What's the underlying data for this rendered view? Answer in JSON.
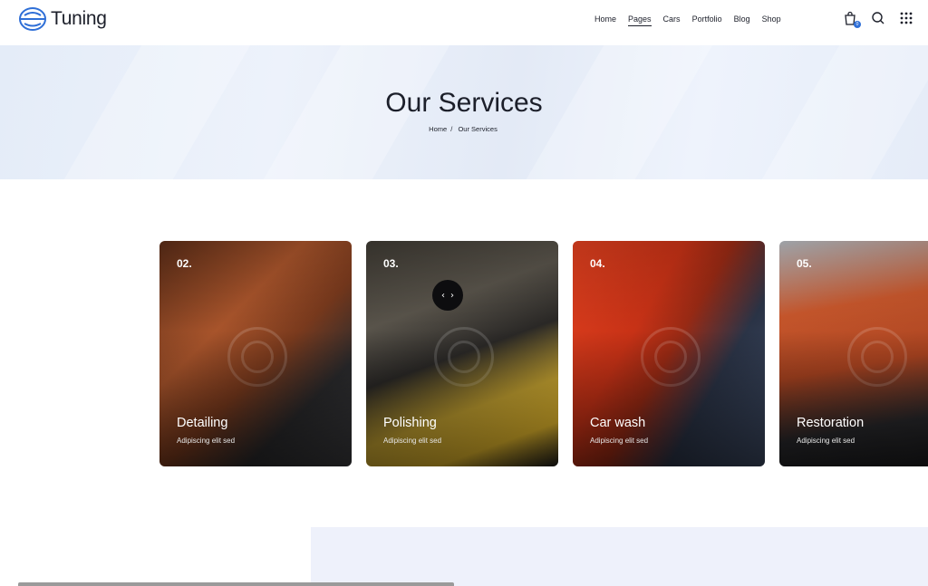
{
  "header": {
    "logo_text": "Tuning",
    "nav": [
      "Home",
      "Pages",
      "Cars",
      "Portfolio",
      "Blog",
      "Shop"
    ],
    "active_nav": "Pages",
    "cart_count": "0",
    "icons": [
      "cart-icon",
      "search-icon",
      "grid-menu-icon"
    ]
  },
  "hero": {
    "title": "Our Services",
    "breadcrumb": {
      "home": "Home",
      "separator": "/",
      "current": "Our Services"
    }
  },
  "services": [
    {
      "number": "02.",
      "title": "Detailing",
      "subtitle": "Adipiscing elit sed"
    },
    {
      "number": "03.",
      "title": "Polishing",
      "subtitle": "Adipiscing elit sed"
    },
    {
      "number": "04.",
      "title": "Car wash",
      "subtitle": "Adipiscing elit sed"
    },
    {
      "number": "05.",
      "title": "Restoration",
      "subtitle": "Adipiscing elit sed"
    }
  ],
  "slider": {
    "prev": "‹",
    "next": "›"
  },
  "colors": {
    "accent": "#2f6fd7",
    "text": "#1c1f2a",
    "hero_bg": "#e8eef9"
  }
}
